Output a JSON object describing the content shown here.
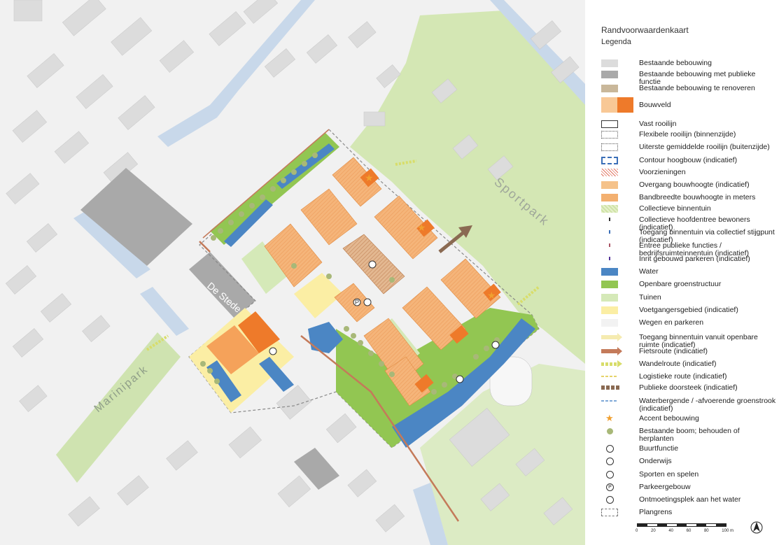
{
  "legend": {
    "title": "Randvoorwaardenkaart",
    "subtitle": "Legenda",
    "items": [
      {
        "label": "Bestaande bebouwing",
        "swatch": "fill",
        "color": "#dcdcdc"
      },
      {
        "label": "Bestaande bebouwing met publieke functie",
        "swatch": "fill",
        "color": "#a9a9a9"
      },
      {
        "label": "Bestaande bebouwing te renoveren",
        "swatch": "fill",
        "color": "#c9b79a"
      },
      {
        "label": "Bouwveld",
        "swatch": "bouwveld",
        "color": "#f5a25a"
      },
      {
        "label": "Vast rooilijn",
        "swatch": "outline",
        "color": "#333333"
      },
      {
        "label": "Flexibele rooilijn (binnenzijde)",
        "swatch": "dotted",
        "color": "#555555"
      },
      {
        "label": "Uiterste gemiddelde rooilijn (buitenzijde)",
        "swatch": "dotted",
        "color": "#555555"
      },
      {
        "label": "Contour hoogbouw (indicatief)",
        "swatch": "dashed-blue",
        "color": "#3b6fb8"
      },
      {
        "label": "Voorzieningen",
        "swatch": "hatch-red",
        "color": "#e0705c"
      },
      {
        "label": "Overgang bouwhoogte (indicatief)",
        "swatch": "fill",
        "color": "#f5c28a"
      },
      {
        "label": "Bandbreedte bouwhoogte in meters",
        "swatch": "fill",
        "color": "#f3b070"
      },
      {
        "label": "Collectieve binnentuin",
        "swatch": "hatch-green",
        "color": "#cfe3a6"
      },
      {
        "label": "Collectieve hoofdentree bewoners (indicatief)",
        "swatch": "marker",
        "color": "#333333"
      },
      {
        "label": "Toegang binnentuin via collectief stijgpunt (indicatief)",
        "swatch": "marker",
        "color": "#3b6fb8"
      },
      {
        "label": "Entree publieke functies / bedrijfsruimteinnentuin (indicatief)",
        "swatch": "marker",
        "color": "#aa5566"
      },
      {
        "label": "Inrit gebouwd parkeren (indicatief)",
        "swatch": "marker",
        "color": "#553399"
      },
      {
        "label": "Water",
        "swatch": "fill",
        "color": "#4b86c4"
      },
      {
        "label": "Openbare groenstructuur",
        "swatch": "fill",
        "color": "#92c652"
      },
      {
        "label": "Tuinen",
        "swatch": "fill",
        "color": "#d5e9b8"
      },
      {
        "label": "Voetgangersgebied (indicatief)",
        "swatch": "fill",
        "color": "#fbeea4"
      },
      {
        "label": "Wegen en parkeren",
        "swatch": "fill",
        "color": "#f2f2f2"
      },
      {
        "label": "Toegang binnentuin vanuit openbare ruimte (indicatief)",
        "swatch": "arrow",
        "color": "#f5ebb0"
      },
      {
        "label": "Fietsroute (indicatief)",
        "swatch": "arrow",
        "color": "#c47a5a"
      },
      {
        "label": "Wandelroute (indicatief)",
        "swatch": "arrow-dash",
        "color": "#d8dd6a"
      },
      {
        "label": "Logistieke route (indicatief)",
        "swatch": "dash-line",
        "color": "#e5d36a"
      },
      {
        "label": "Publieke doorsteek (indicatief)",
        "swatch": "double-arrow",
        "color": "#8a6a52"
      },
      {
        "label": "Waterbergende / -afvoerende groenstrook (indicatief)",
        "swatch": "dash-line",
        "color": "#7fa9d8"
      },
      {
        "label": "Accent bebouwing",
        "swatch": "star",
        "color": "#f0a030"
      },
      {
        "label": "Bestaande boom; behouden of herplanten",
        "swatch": "dot",
        "color": "#a8b878"
      },
      {
        "label": "Buurtfunctie",
        "swatch": "circle-icon",
        "color": "#333333"
      },
      {
        "label": "Onderwijs",
        "swatch": "circle-icon",
        "color": "#333333"
      },
      {
        "label": "Sporten en spelen",
        "swatch": "circle-icon",
        "color": "#333333"
      },
      {
        "label": "Parkeergebouw",
        "swatch": "circle-p",
        "color": "#333333"
      },
      {
        "label": "Ontmoetingsplek aan het water",
        "swatch": "circle-icon",
        "color": "#333333"
      },
      {
        "label": "Plangrens",
        "swatch": "dashed-gray",
        "color": "#777777"
      }
    ]
  },
  "map": {
    "sportpark_label": "Sportpark",
    "marinipark_label": "Marinipark",
    "building_label": "De Stede"
  },
  "scale": {
    "ticks": [
      "0",
      "20",
      "40",
      "60",
      "80",
      "100 m"
    ]
  },
  "north_arrow": "N",
  "colors": {
    "background": "#f1f1f1",
    "existing_building": "#dcdcdc",
    "public_building": "#a9a9a9",
    "water": "#4b86c4",
    "canal": "#c8d8ea",
    "green_public": "#92c652",
    "gardens": "#d5e9b8",
    "park": "#cfe3b0",
    "pedestrian": "#fbeea4",
    "bouwveld": "#f5b57a",
    "bouwveld_dark": "#ee7a2a",
    "cycle_route": "#c47a5a",
    "tree": "#a8b878"
  }
}
